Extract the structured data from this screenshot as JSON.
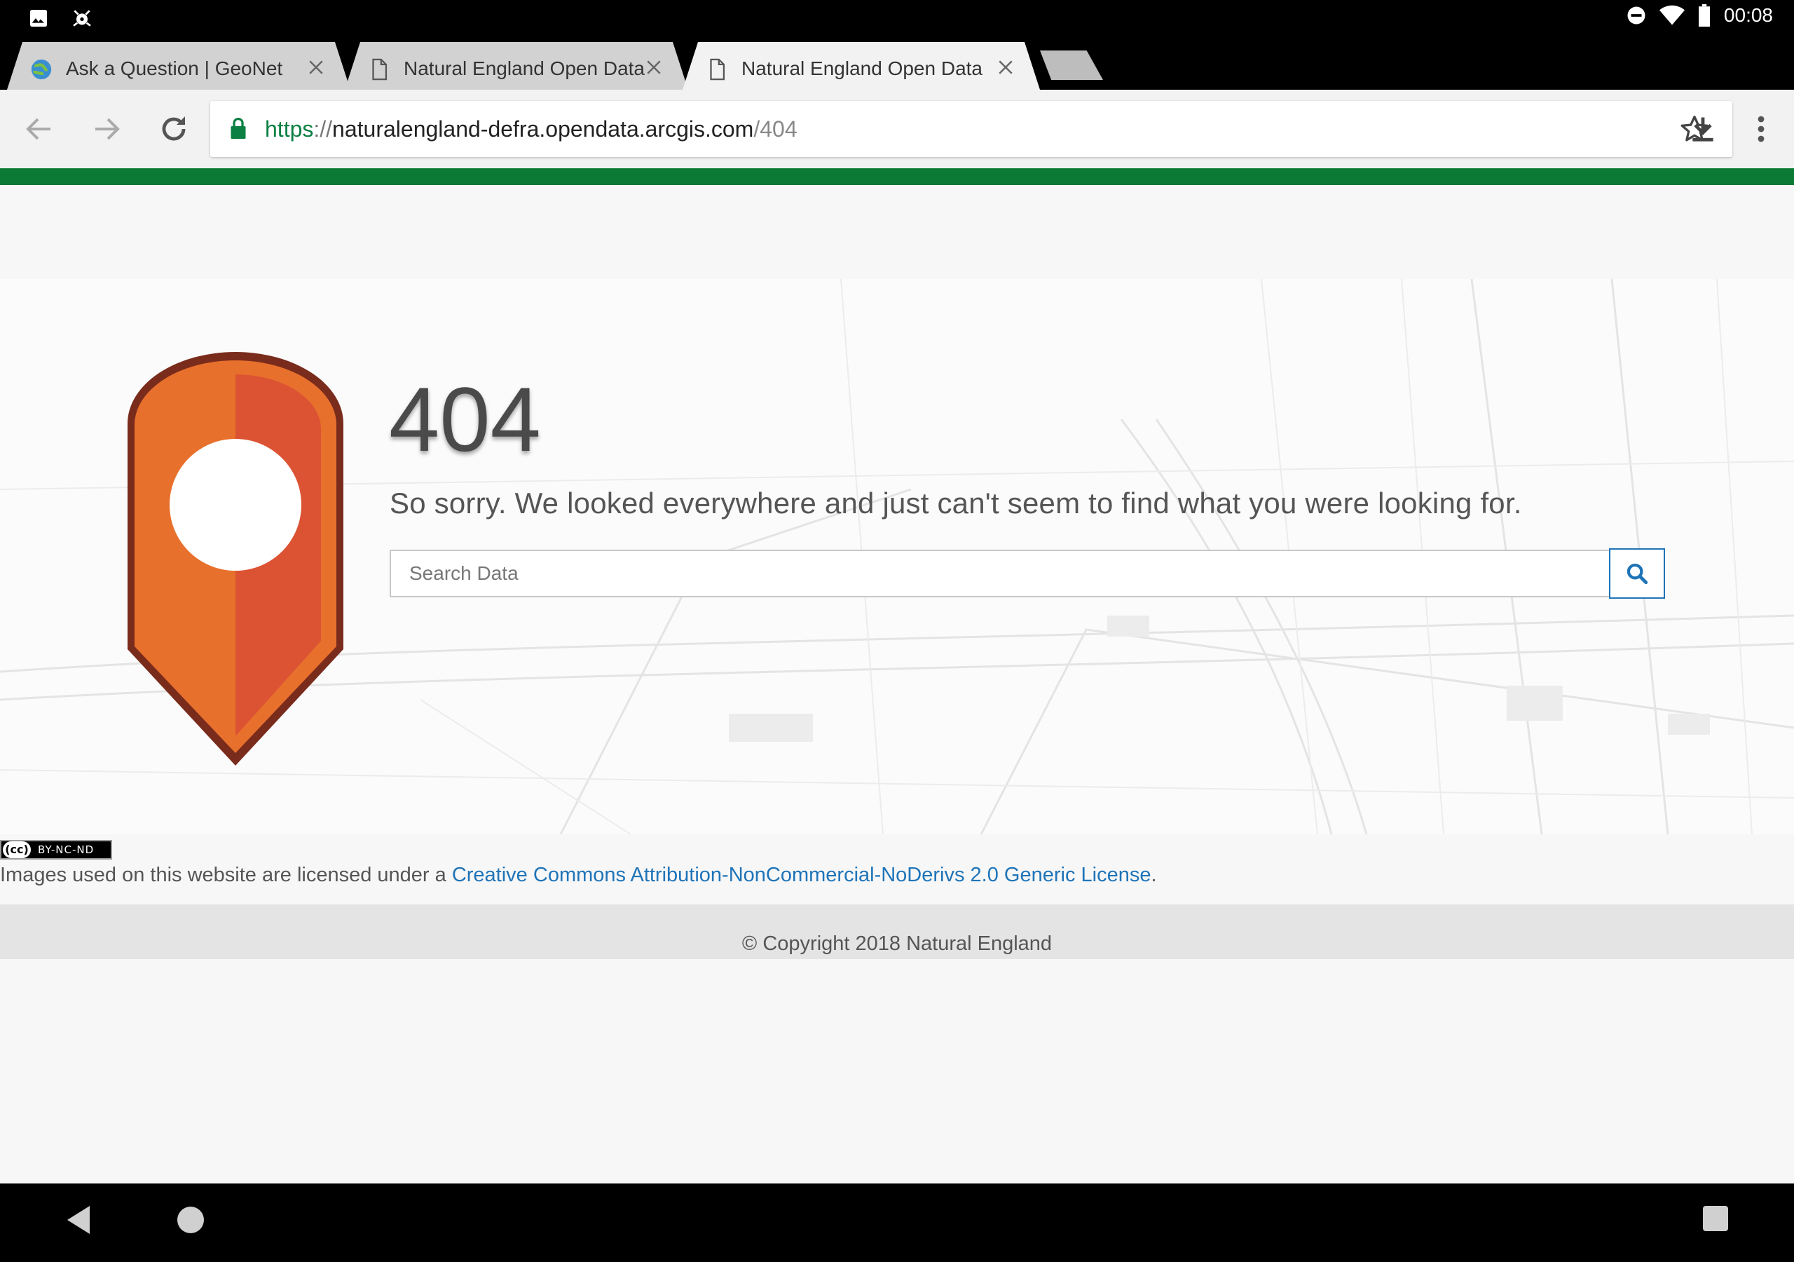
{
  "status_bar": {
    "time": "00:08",
    "left_icons": [
      "image-icon",
      "bug-icon"
    ],
    "right_icons": [
      "do-not-disturb-icon",
      "wifi-icon",
      "battery-icon"
    ]
  },
  "tabs": [
    {
      "title": "Ask a Question | GeoNet",
      "favicon": "geonet-globe-icon",
      "active": false
    },
    {
      "title": "Natural England Open Data",
      "favicon": "page-icon",
      "active": false
    },
    {
      "title": "Natural England Open Data",
      "favicon": "page-icon",
      "active": true
    }
  ],
  "toolbar": {
    "url_scheme": "https",
    "url_sep": "://",
    "url_host": "naturalengland-defra.opendata.arcgis.com",
    "url_path": "/404"
  },
  "error": {
    "code": "404",
    "message": "So sorry. We looked everywhere and just can't seem to find what you were looking for."
  },
  "search": {
    "placeholder": "Search Data",
    "value": ""
  },
  "license": {
    "badge_mark": "(cc)",
    "badge_text": "BY-NC-ND",
    "prefix": "Images used on this website are licensed under a ",
    "link_text": "Creative Commons Attribution-NonCommercial-NoDerivs 2.0 Generic License",
    "suffix": "."
  },
  "footer": {
    "copyright": "© Copyright 2018 Natural England"
  },
  "colors": {
    "accent_green": "#0b7a35",
    "link_blue": "#1f74b8",
    "pin_orange": "#e8702d",
    "pin_red": "#dc5333",
    "pin_border": "#7a2c1c"
  }
}
